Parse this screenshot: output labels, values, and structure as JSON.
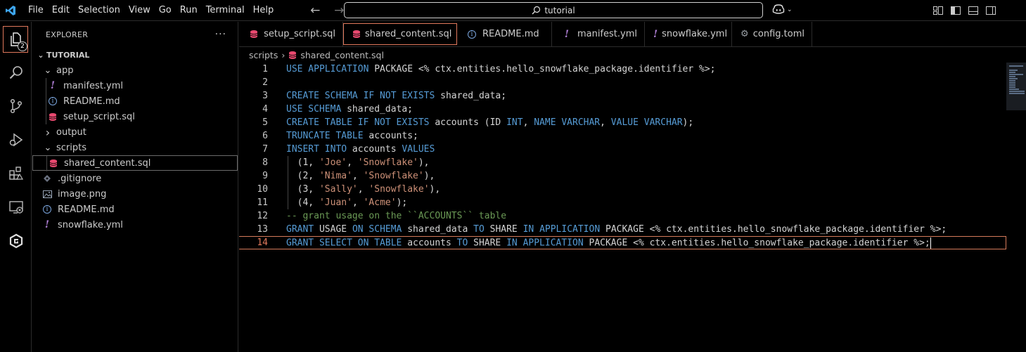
{
  "titlebar": {
    "menu": [
      "File",
      "Edit",
      "Selection",
      "View",
      "Go",
      "Run",
      "Terminal",
      "Help"
    ],
    "search_text": "tutorial"
  },
  "activitybar": {
    "badge": "2",
    "icons": [
      "explorer-icon",
      "search-icon",
      "source-control-icon",
      "run-debug-icon",
      "extensions-icon",
      "remote-explorer-icon",
      "gitkraken-icon"
    ]
  },
  "explorer": {
    "title": "EXPLORER",
    "more": "···",
    "root": "TUTORIAL",
    "tree": [
      {
        "label": "app",
        "type": "folder-open",
        "depth": 1
      },
      {
        "label": "manifest.yml",
        "type": "yml",
        "depth": 2
      },
      {
        "label": "README.md",
        "type": "md",
        "depth": 2
      },
      {
        "label": "setup_script.sql",
        "type": "sql",
        "depth": 2
      },
      {
        "label": "output",
        "type": "folder-closed",
        "depth": 1
      },
      {
        "label": "scripts",
        "type": "folder-open",
        "depth": 1
      },
      {
        "label": "shared_content.sql",
        "type": "sql",
        "depth": 2,
        "selected": true
      },
      {
        "label": ".gitignore",
        "type": "git",
        "depth": 1
      },
      {
        "label": "image.png",
        "type": "image",
        "depth": 1
      },
      {
        "label": "README.md",
        "type": "md",
        "depth": 1
      },
      {
        "label": "snowflake.yml",
        "type": "yml",
        "depth": 1
      }
    ]
  },
  "tabs": [
    {
      "label": "setup_script.sql",
      "icon": "sql",
      "dirty": false,
      "active": false
    },
    {
      "label": "shared_content.sql",
      "icon": "sql",
      "dirty": true,
      "active": true
    },
    {
      "label": "README.md",
      "icon": "md",
      "dirty": false,
      "active": false
    },
    {
      "label": "manifest.yml",
      "icon": "yml",
      "dirty": false,
      "active": false
    },
    {
      "label": "snowflake.yml",
      "icon": "yml",
      "dirty": true,
      "active": false
    },
    {
      "label": "config.toml",
      "icon": "gear",
      "dirty": false,
      "active": false
    }
  ],
  "breadcrumb": {
    "folder": "scripts",
    "file": "shared_content.sql"
  },
  "editor": {
    "current_line": 14,
    "lines": [
      [
        {
          "t": "USE APPLICATION ",
          "c": "kw"
        },
        {
          "t": "PACKAGE <% ctx.entities.hello_snowflake_package.identifier %>;",
          "c": ""
        }
      ],
      [],
      [
        {
          "t": "CREATE SCHEMA IF NOT EXISTS ",
          "c": "kw"
        },
        {
          "t": "shared_data;",
          "c": ""
        }
      ],
      [
        {
          "t": "USE SCHEMA ",
          "c": "kw"
        },
        {
          "t": "shared_data;",
          "c": ""
        }
      ],
      [
        {
          "t": "CREATE TABLE IF NOT EXISTS ",
          "c": "kw"
        },
        {
          "t": "accounts (ID ",
          "c": ""
        },
        {
          "t": "INT",
          "c": "kw"
        },
        {
          "t": ", ",
          "c": ""
        },
        {
          "t": "NAME VARCHAR",
          "c": "kw"
        },
        {
          "t": ", ",
          "c": ""
        },
        {
          "t": "VALUE VARCHAR",
          "c": "kw"
        },
        {
          "t": ");",
          "c": ""
        }
      ],
      [
        {
          "t": "TRUNCATE TABLE ",
          "c": "kw"
        },
        {
          "t": "accounts;",
          "c": ""
        }
      ],
      [
        {
          "t": "INSERT INTO ",
          "c": "kw"
        },
        {
          "t": "accounts ",
          "c": ""
        },
        {
          "t": "VALUES",
          "c": "kw"
        }
      ],
      [
        {
          "t": "  (1, ",
          "c": ""
        },
        {
          "t": "'Joe'",
          "c": "str"
        },
        {
          "t": ", ",
          "c": ""
        },
        {
          "t": "'Snowflake'",
          "c": "str"
        },
        {
          "t": "),",
          "c": ""
        }
      ],
      [
        {
          "t": "  (2, ",
          "c": ""
        },
        {
          "t": "'Nima'",
          "c": "str"
        },
        {
          "t": ", ",
          "c": ""
        },
        {
          "t": "'Snowflake'",
          "c": "str"
        },
        {
          "t": "),",
          "c": ""
        }
      ],
      [
        {
          "t": "  (3, ",
          "c": ""
        },
        {
          "t": "'Sally'",
          "c": "str"
        },
        {
          "t": ", ",
          "c": ""
        },
        {
          "t": "'Snowflake'",
          "c": "str"
        },
        {
          "t": "),",
          "c": ""
        }
      ],
      [
        {
          "t": "  (4, ",
          "c": ""
        },
        {
          "t": "'Juan'",
          "c": "str"
        },
        {
          "t": ", ",
          "c": ""
        },
        {
          "t": "'Acme'",
          "c": "str"
        },
        {
          "t": ");",
          "c": ""
        }
      ],
      [
        {
          "t": "-- grant usage on the ``ACCOUNTS`` table",
          "c": "cm"
        }
      ],
      [
        {
          "t": "GRANT ",
          "c": "kw"
        },
        {
          "t": "USAGE ",
          "c": ""
        },
        {
          "t": "ON SCHEMA ",
          "c": "kw"
        },
        {
          "t": "shared_data ",
          "c": ""
        },
        {
          "t": "TO ",
          "c": "kw"
        },
        {
          "t": "SHARE ",
          "c": ""
        },
        {
          "t": "IN APPLICATION ",
          "c": "kw"
        },
        {
          "t": "PACKAGE <% ctx.entities.hello_snowflake_package.identifier %>;",
          "c": ""
        }
      ],
      [
        {
          "t": "GRANT SELECT ON TABLE ",
          "c": "kw"
        },
        {
          "t": "accounts ",
          "c": ""
        },
        {
          "t": "TO ",
          "c": "kw"
        },
        {
          "t": "SHARE ",
          "c": ""
        },
        {
          "t": "IN APPLICATION ",
          "c": "kw"
        },
        {
          "t": "PACKAGE <% ctx.entities.hello_snowflake_package.identifier %>;",
          "c": ""
        }
      ]
    ]
  },
  "colors": {
    "accent": "#e0785c",
    "keyword": "#569cd6",
    "string": "#ce9178",
    "comment": "#6a9955"
  }
}
